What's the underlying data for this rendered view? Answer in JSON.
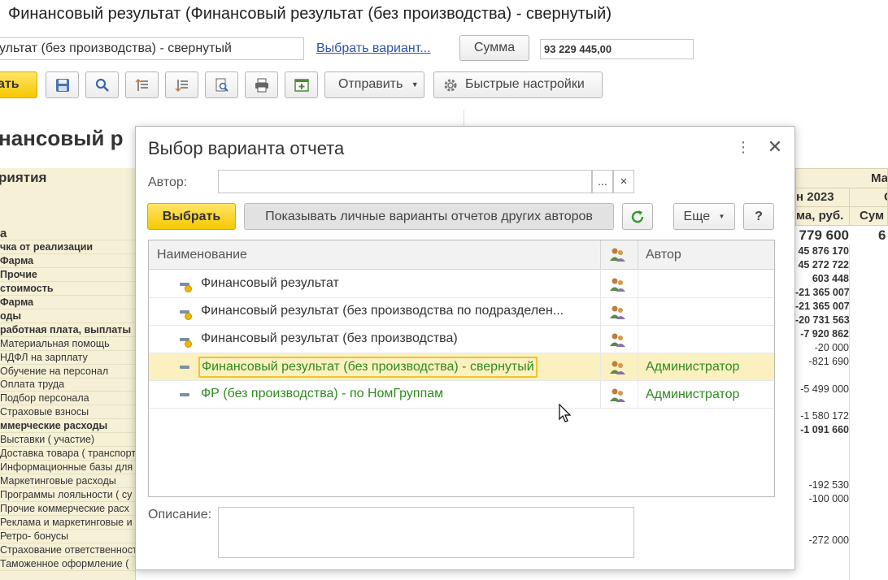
{
  "window": {
    "title": "Финансовый результат (Финансовый результат (без производства) - свернутый)",
    "variant_value": "ультат (без производства) - свернутый",
    "choose_variant_link": "Выбрать вариант...",
    "sum_button": "Сумма",
    "sum_value": "93 229 445,00"
  },
  "toolbar": {
    "generate_label": "ать",
    "send_label": "Отправить",
    "quick_settings_label": "Быстрые настройки"
  },
  "report": {
    "title": "нансовый р",
    "enterprise_header": "риятия",
    "rows": [
      {
        "label": "а",
        "bold": true
      },
      {
        "label": "чка от реализации",
        "bold": true
      },
      {
        "label": "Фарма",
        "bold": true
      },
      {
        "label": "Прочие",
        "bold": true
      },
      {
        "label": "стоимость",
        "bold": true
      },
      {
        "label": "Фарма",
        "bold": true
      },
      {
        "label": "оды",
        "bold": true
      },
      {
        "label": "работная плата, выплаты",
        "bold": true
      },
      {
        "label": "Материальная помощь",
        "bold": false
      },
      {
        "label": "НДФЛ на зарплату",
        "bold": false
      },
      {
        "label": "Обучение на персонал",
        "bold": false
      },
      {
        "label": "Оплата труда",
        "bold": false
      },
      {
        "label": "Подбор персонала",
        "bold": false
      },
      {
        "label": "Страховые взносы",
        "bold": false
      },
      {
        "label": "ммерческие расходы",
        "bold": true
      },
      {
        "label": "Выставки ( участие)",
        "bold": false
      },
      {
        "label": "Доставка товара ( транспорт",
        "bold": false
      },
      {
        "label": "Информационные базы для",
        "bold": false
      },
      {
        "label": "Маркетинговые расходы",
        "bold": false
      },
      {
        "label": "Программы лояльности ( су",
        "bold": false
      },
      {
        "label": "Прочие коммерческие расх",
        "bold": false
      },
      {
        "label": "Реклама и маркетинговые и",
        "bold": false
      },
      {
        "label": "Ретро- бонусы",
        "bold": false
      },
      {
        "label": "Страхование ответственност",
        "bold": false
      },
      {
        "label": "Таможенное  оформление (",
        "bold": false
      }
    ],
    "right_header_top": "Ма",
    "right_header_month": "н 2023",
    "right_header_month2": "С",
    "right_header_sum": "ма, руб.",
    "right_header_sum2": "Сум",
    "right_total": "779 600",
    "right_total2": "6",
    "right_values": [
      {
        "value": "45 876 170",
        "bold": true
      },
      {
        "value": "45 272 722",
        "bold": true
      },
      {
        "value": "603 448",
        "bold": true
      },
      {
        "value": "-21 365 007",
        "bold": true
      },
      {
        "value": "-21 365 007",
        "bold": true
      },
      {
        "value": "-20 731 563",
        "bold": true
      },
      {
        "value": "-7 920 862",
        "bold": true
      },
      {
        "value": "-20 000",
        "bold": false
      },
      {
        "value": "-821 690",
        "bold": false
      },
      {
        "value": "",
        "bold": false
      },
      {
        "value": "-5 499 000",
        "bold": false
      },
      {
        "value": "",
        "bold": false
      },
      {
        "value": "-1 580 172",
        "bold": false
      },
      {
        "value": "-1 091 660",
        "bold": true
      },
      {
        "value": "",
        "bold": false
      },
      {
        "value": "",
        "bold": false
      },
      {
        "value": "",
        "bold": false
      },
      {
        "value": "-192 530",
        "bold": false
      },
      {
        "value": "-100 000",
        "bold": false
      },
      {
        "value": "",
        "bold": false
      },
      {
        "value": "",
        "bold": false
      },
      {
        "value": "-272 000",
        "bold": false
      }
    ]
  },
  "dialog": {
    "title": "Выбор варианта отчета",
    "author_label": "Автор:",
    "author_value": "",
    "dots_label": "...",
    "clear_label": "×",
    "select_button": "Выбрать",
    "show_personal_button": "Показывать личные варианты отчетов других авторов",
    "more_button": "Еще",
    "help_button": "?",
    "list": {
      "col_name": "Наименование",
      "col_author": "Автор",
      "rows": [
        {
          "name": "Финансовый результат",
          "author": "",
          "predefined": true,
          "selected": false
        },
        {
          "name": "Финансовый результат (без производства по подразделен...",
          "author": "",
          "predefined": true,
          "selected": false
        },
        {
          "name": "Финансовый результат (без производства)",
          "author": "",
          "predefined": true,
          "selected": false
        },
        {
          "name": "Финансовый результат (без производства) - свернутый",
          "author": "Администратор",
          "predefined": false,
          "selected": true
        },
        {
          "name": "ФР (без производства) - по НомГруппам",
          "author": "Администратор",
          "predefined": false,
          "selected": false
        }
      ]
    },
    "description_label": "Описание:",
    "description_value": ""
  },
  "colors": {
    "accent_yellow": "#f5c800",
    "link_blue": "#2f54a8",
    "user_green": "#2e8b1e",
    "selection": "#fbf0c0",
    "report_header_bg": "#f6f1d6"
  }
}
